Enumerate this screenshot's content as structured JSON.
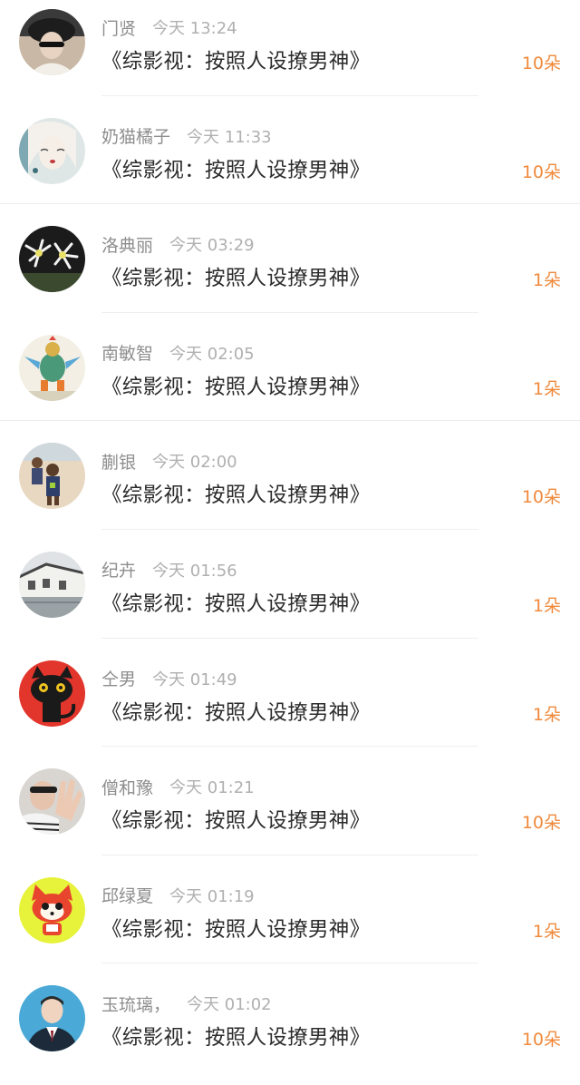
{
  "items": [
    {
      "user": "门贤",
      "time": "今天 13:24",
      "title": "《综影视：按照人设撩男神》",
      "gift": "10朵",
      "avatar": "dark-hat-person-icon"
    },
    {
      "user": "奶猫橘子",
      "time": "今天 11:33",
      "title": "《综影视：按照人设撩男神》",
      "gift": "10朵",
      "avatar": "painted-woman-icon"
    },
    {
      "user": "洛典丽",
      "time": "今天 03:29",
      "title": "《综影视：按照人设撩男神》",
      "gift": "1朵",
      "avatar": "white-flowers-icon"
    },
    {
      "user": "南敏智",
      "time": "今天 02:05",
      "title": "《综影视：按照人设撩男神》",
      "gift": "1朵",
      "avatar": "cartoon-bird-icon"
    },
    {
      "user": "蒯银",
      "time": "今天 02:00",
      "title": "《综影视：按照人设撩男神》",
      "gift": "10朵",
      "avatar": "children-beach-icon"
    },
    {
      "user": "纪卉",
      "time": "今天 01:56",
      "title": "《综影视：按照人设撩男神》",
      "gift": "1朵",
      "avatar": "old-building-icon"
    },
    {
      "user": "仝男",
      "time": "今天 01:49",
      "title": "《综影视：按照人设撩男神》",
      "gift": "1朵",
      "avatar": "black-cat-icon"
    },
    {
      "user": "僧和豫",
      "time": "今天 01:21",
      "title": "《综影视：按照人设撩男神》",
      "gift": "10朵",
      "avatar": "waving-person-icon"
    },
    {
      "user": "邱绿夏",
      "time": "今天 01:19",
      "title": "《综影视：按照人设撩男神》",
      "gift": "1朵",
      "avatar": "cartoon-fox-icon"
    },
    {
      "user": "玉琉璃，",
      "time": "今天 01:02",
      "title": "《综影视：按照人设撩男神》",
      "gift": "10朵",
      "avatar": "man-in-suit-icon"
    }
  ],
  "colors": {
    "gift": "#f08a3c",
    "username": "#8e8e8e",
    "time": "#b0b0b0",
    "title": "#2b2b2b"
  }
}
